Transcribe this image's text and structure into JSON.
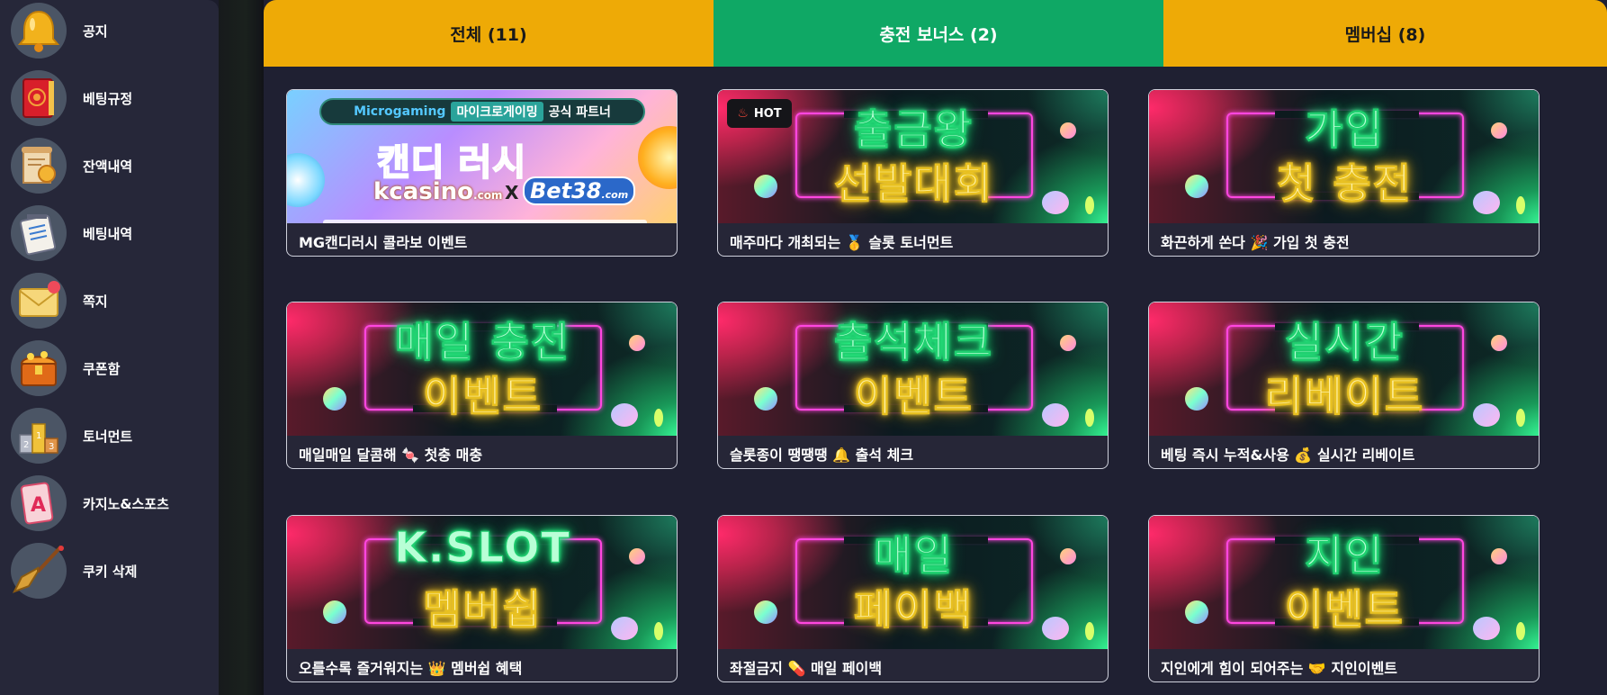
{
  "sidebar": {
    "items": [
      {
        "label": "공지",
        "icon": "bell-icon"
      },
      {
        "label": "베팅규정",
        "icon": "rulebook-icon"
      },
      {
        "label": "잔액내역",
        "icon": "scroll-icon"
      },
      {
        "label": "베팅내역",
        "icon": "notepad-icon"
      },
      {
        "label": "쪽지",
        "icon": "envelope-icon"
      },
      {
        "label": "쿠폰함",
        "icon": "treasure-chest-icon"
      },
      {
        "label": "토너먼트",
        "icon": "podium-icon"
      },
      {
        "label": "카지노&스포츠",
        "icon": "playing-card-icon"
      },
      {
        "label": "쿠키 삭제",
        "icon": "broom-icon"
      }
    ]
  },
  "tabs": [
    {
      "label": "전체 (11)",
      "color": "#eeaa06"
    },
    {
      "label": "충전 보너스 (2)",
      "color": "#0fa865",
      "active": true
    },
    {
      "label": "멤버십 (8)",
      "color": "#eeaa06"
    }
  ],
  "cards": [
    {
      "caption": "MG캔디러시 콜라보 이벤트",
      "banner": {
        "top_logo": "Microgaming",
        "top_kr": "마이크로게이밍",
        "top_suffix": "공식 파트너",
        "title": "캔디 러시",
        "brand1": "kcasino",
        "brand1_sub": ".com",
        "x": "X",
        "brand2": "Bet38",
        "brand2_sub": ".com"
      }
    },
    {
      "caption": "매주마다 개최되는 🥇 슬롯 토너먼트",
      "line1": "출금왕",
      "line2": "선발대회",
      "badge": "HOT"
    },
    {
      "caption": "화끈하게 쏜다 🎉 가입 첫 충전",
      "line1": "가입",
      "line2": "첫 충전"
    },
    {
      "caption": "매일매일 달콤해 🍬 첫충 매충",
      "line1": "매일 충전",
      "line2": "이벤트"
    },
    {
      "caption": "슬롯종이 땡땡땡 🔔 출석 체크",
      "line1": "출석체크",
      "line2": "이벤트"
    },
    {
      "caption": "베팅 즉시 누적&사용 💰 실시간 리베이트",
      "line1": "실시간",
      "line2": "리베이트"
    },
    {
      "caption": "오를수록 즐거워지는 👑 멤버쉽 혜택",
      "line1": "K.SLOT",
      "line2": "멤버쉽"
    },
    {
      "caption": "좌절금지 💊 매일 페이백",
      "line1": "매일",
      "line2": "페이백"
    },
    {
      "caption": "지인에게 힘이 되어주는 🤝 지인이벤트",
      "line1": "지인",
      "line2": "이벤트"
    }
  ],
  "colors": {
    "tab_yellow": "#eeaa06",
    "tab_green": "#0fa865",
    "sidebar_bg": "#262739",
    "main_bg": "#1f2032",
    "neon_green": "#2cff8a",
    "neon_yellow": "#ffd93a",
    "neon_pink": "#ff46e0"
  }
}
